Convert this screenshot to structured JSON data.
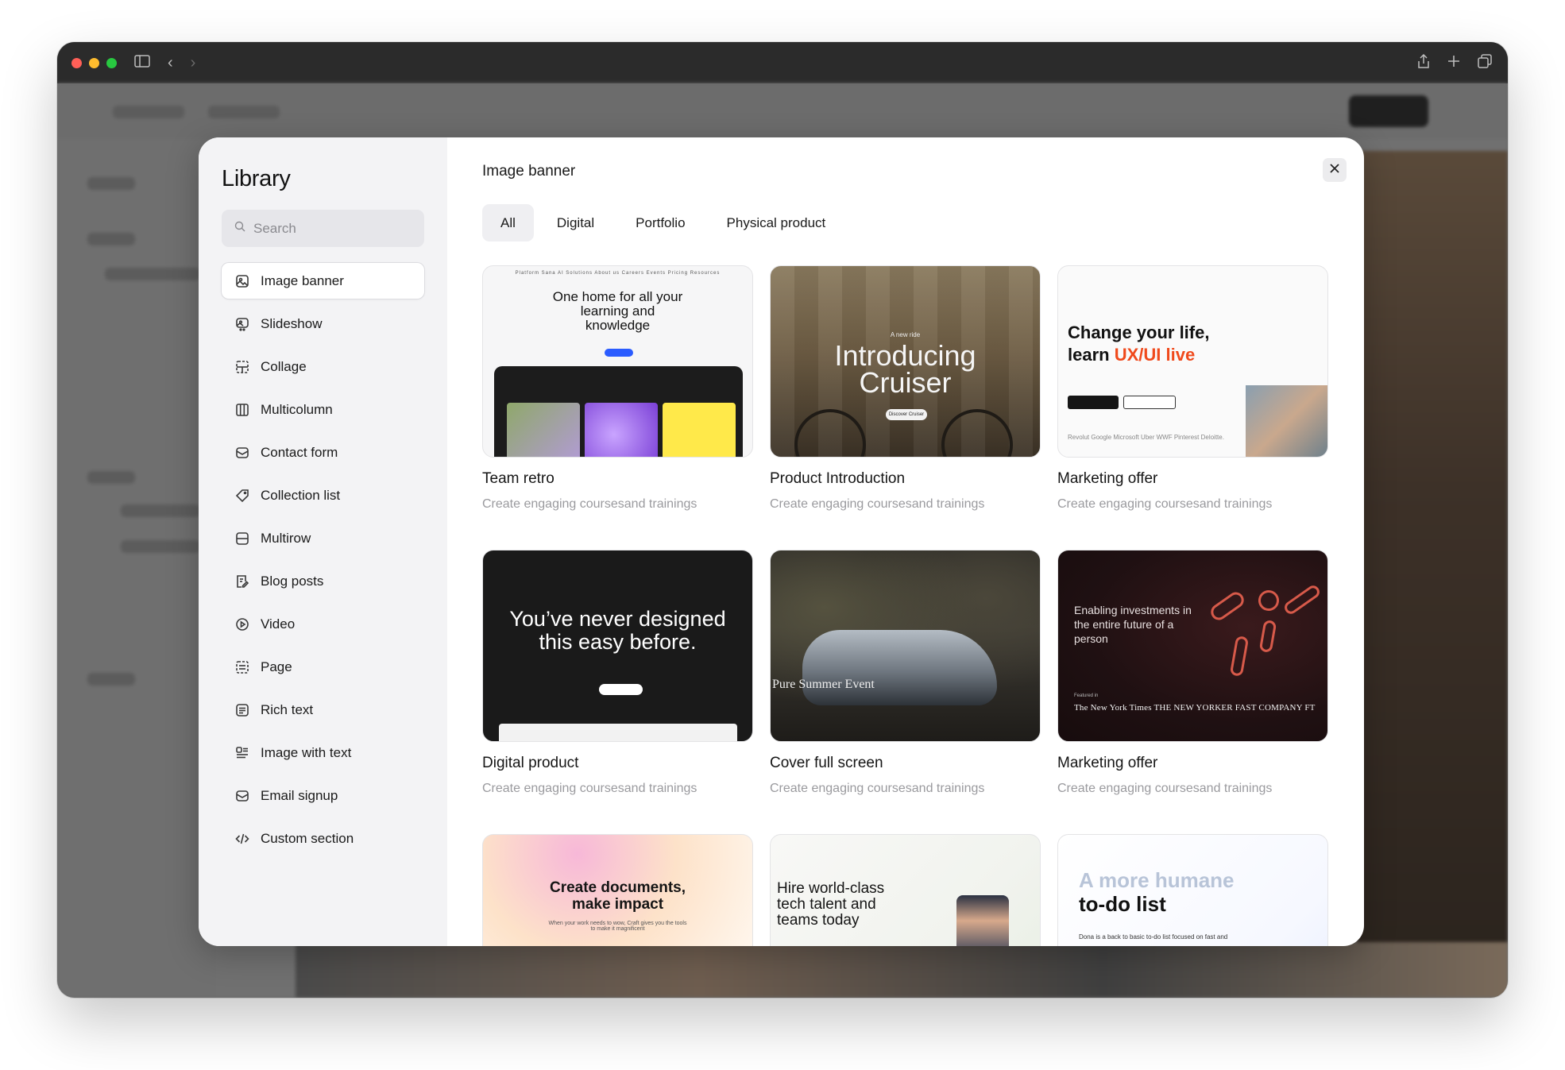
{
  "library": {
    "title": "Library",
    "search_placeholder": "Search",
    "items": [
      {
        "label": "Image banner",
        "icon": "image-icon",
        "active": true
      },
      {
        "label": "Slideshow",
        "icon": "slideshow-icon"
      },
      {
        "label": "Collage",
        "icon": "collage-icon"
      },
      {
        "label": "Multicolumn",
        "icon": "columns-icon"
      },
      {
        "label": "Contact form",
        "icon": "mail-icon"
      },
      {
        "label": "Collection list",
        "icon": "tag-icon"
      },
      {
        "label": "Multirow",
        "icon": "rows-icon"
      },
      {
        "label": "Blog posts",
        "icon": "document-edit-icon"
      },
      {
        "label": "Video",
        "icon": "play-icon"
      },
      {
        "label": "Page",
        "icon": "page-icon"
      },
      {
        "label": "Rich text",
        "icon": "text-icon"
      },
      {
        "label": "Image with text",
        "icon": "image-text-icon"
      },
      {
        "label": "Email signup",
        "icon": "mail-icon"
      },
      {
        "label": "Custom section",
        "icon": "code-icon"
      }
    ]
  },
  "main": {
    "title": "Image banner",
    "tabs": [
      "All",
      "Digital",
      "Portfolio",
      "Physical product"
    ],
    "active_tab": "All"
  },
  "cards": [
    {
      "title": "Team retro",
      "desc": "Create engaging coursesand trainings",
      "thumb": {
        "nav": "Platform   Sana AI   Solutions   About us   Careers   Events   Pricing   Resources",
        "headline": "One home for all your learning and knowledge"
      }
    },
    {
      "title": "Product Introduction",
      "desc": "Create engaging coursesand trainings",
      "thumb": {
        "kicker": "A new ride",
        "headline": "Introducing Cruiser",
        "button": "Discover Cruiser"
      }
    },
    {
      "title": "Marketing offer",
      "desc": "Create engaging coursesand trainings",
      "thumb": {
        "headline_a": "Change your life,",
        "headline_b": "learn ",
        "headline_accent": "UX/UI live",
        "logos": "Revolut   Google   Microsoft   Uber   WWF   Pinterest   Deloitte."
      }
    },
    {
      "title": "Digital product",
      "desc": "Create engaging coursesand trainings",
      "thumb": {
        "headline": "You’ve never designed this easy before."
      }
    },
    {
      "title": "Cover full screen",
      "desc": "Create engaging coursesand trainings",
      "thumb": {
        "headline": "Pure Summer Event"
      }
    },
    {
      "title": "Marketing offer",
      "desc": "Create engaging coursesand trainings",
      "thumb": {
        "headline": "Enabling investments in the entire future of a person",
        "featured": "Featured in",
        "brands": "The New York Times   THE NEW YORKER   FAST COMPANY   FT"
      }
    },
    {
      "title": "",
      "desc": "",
      "thumb": {
        "headline": "Create documents, make impact",
        "sub": "When your work needs to wow, Craft gives you the tools to make it magnificent"
      }
    },
    {
      "title": "",
      "desc": "",
      "thumb": {
        "headline": "Hire world-class tech talent and teams today"
      }
    },
    {
      "title": "",
      "desc": "",
      "thumb": {
        "headline_a": "A more humane",
        "headline_b": "to-do list",
        "sub": "Dona is a back to basic to-do list focused on fast and"
      }
    }
  ],
  "colors": {
    "accent_orange": "#f04a1c",
    "modal_bg": "#ffffff",
    "sidebar_bg": "#f3f3f5"
  }
}
